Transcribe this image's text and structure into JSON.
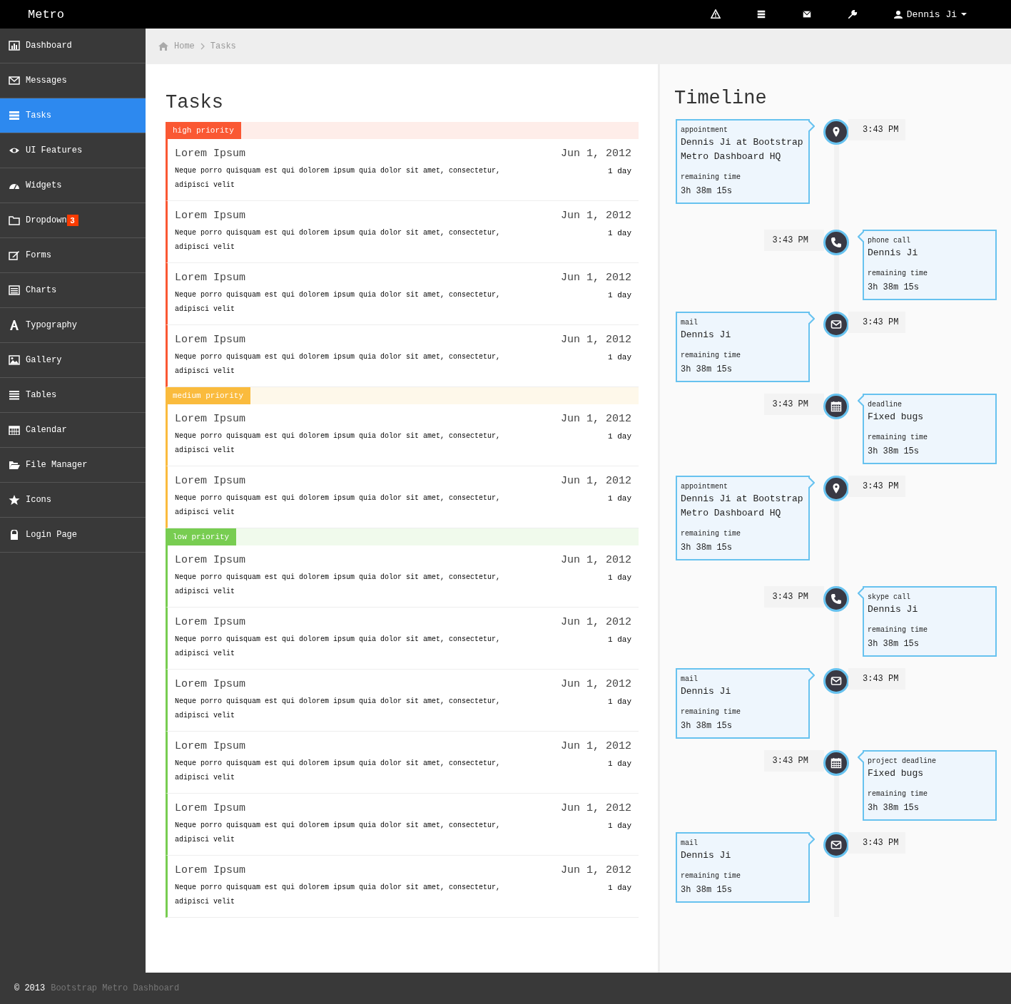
{
  "topbar": {
    "brand": "Metro",
    "user": "Dennis Ji"
  },
  "sidebar": {
    "items": [
      {
        "label": "Dashboard",
        "selected": false
      },
      {
        "label": "Messages",
        "selected": false
      },
      {
        "label": "Tasks",
        "selected": true
      },
      {
        "label": "UI Features",
        "selected": false
      },
      {
        "label": "Widgets",
        "selected": false
      },
      {
        "label": "Dropdown",
        "selected": false,
        "badge": "3"
      },
      {
        "label": "Forms",
        "selected": false
      },
      {
        "label": "Charts",
        "selected": false
      },
      {
        "label": "Typography",
        "selected": false
      },
      {
        "label": "Gallery",
        "selected": false
      },
      {
        "label": "Tables",
        "selected": false
      },
      {
        "label": "Calendar",
        "selected": false
      },
      {
        "label": "File Manager",
        "selected": false
      },
      {
        "label": "Icons",
        "selected": false
      },
      {
        "label": "Login Page",
        "selected": false
      }
    ]
  },
  "breadcrumb": [
    "Home",
    "Tasks"
  ],
  "tasks": {
    "title": "Tasks",
    "groups": [
      {
        "label": "high priority",
        "color": "#fa5833",
        "items": [
          {
            "title": "Lorem Ipsum",
            "date": "Jun 1, 2012",
            "text": "Neque porro quisquam est qui dolorem ipsum quia dolor sit amet, consectetur, adipisci velit",
            "duration": "1 day"
          },
          {
            "title": "Lorem Ipsum",
            "date": "Jun 1, 2012",
            "text": "Neque porro quisquam est qui dolorem ipsum quia dolor sit amet, consectetur, adipisci velit",
            "duration": "1 day"
          },
          {
            "title": "Lorem Ipsum",
            "date": "Jun 1, 2012",
            "text": "Neque porro quisquam est qui dolorem ipsum quia dolor sit amet, consectetur, adipisci velit",
            "duration": "1 day"
          },
          {
            "title": "Lorem Ipsum",
            "date": "Jun 1, 2012",
            "text": "Neque porro quisquam est qui dolorem ipsum quia dolor sit amet, consectetur, adipisci velit",
            "duration": "1 day"
          }
        ]
      },
      {
        "label": "medium priority",
        "color": "#fabb3d",
        "items": [
          {
            "title": "Lorem Ipsum",
            "date": "Jun 1, 2012",
            "text": "Neque porro quisquam est qui dolorem ipsum quia dolor sit amet, consectetur, adipisci velit",
            "duration": "1 day"
          },
          {
            "title": "Lorem Ipsum",
            "date": "Jun 1, 2012",
            "text": "Neque porro quisquam est qui dolorem ipsum quia dolor sit amet, consectetur, adipisci velit",
            "duration": "1 day"
          }
        ]
      },
      {
        "label": "low priority",
        "color": "#78cd51",
        "items": [
          {
            "title": "Lorem Ipsum",
            "date": "Jun 1, 2012",
            "text": "Neque porro quisquam est qui dolorem ipsum quia dolor sit amet, consectetur, adipisci velit",
            "duration": "1 day"
          },
          {
            "title": "Lorem Ipsum",
            "date": "Jun 1, 2012",
            "text": "Neque porro quisquam est qui dolorem ipsum quia dolor sit amet, consectetur, adipisci velit",
            "duration": "1 day"
          },
          {
            "title": "Lorem Ipsum",
            "date": "Jun 1, 2012",
            "text": "Neque porro quisquam est qui dolorem ipsum quia dolor sit amet, consectetur, adipisci velit",
            "duration": "1 day"
          },
          {
            "title": "Lorem Ipsum",
            "date": "Jun 1, 2012",
            "text": "Neque porro quisquam est qui dolorem ipsum quia dolor sit amet, consectetur, adipisci velit",
            "duration": "1 day"
          },
          {
            "title": "Lorem Ipsum",
            "date": "Jun 1, 2012",
            "text": "Neque porro quisquam est qui dolorem ipsum quia dolor sit amet, consectetur, adipisci velit",
            "duration": "1 day"
          },
          {
            "title": "Lorem Ipsum",
            "date": "Jun 1, 2012",
            "text": "Neque porro quisquam est qui dolorem ipsum quia dolor sit amet, consectetur, adipisci velit",
            "duration": "1 day"
          }
        ]
      }
    ]
  },
  "timeline": {
    "title": "Timeline",
    "entries": [
      {
        "kind": "left",
        "category": "appointment",
        "title": "Dennis Ji at Bootstrap Metro Dashboard HQ",
        "label": "remaining time",
        "remaining": "3h 38m 15s",
        "time": "3:43 PM"
      },
      {
        "kind": "right",
        "category": "phone call",
        "title": "Dennis Ji",
        "label": "remaining time",
        "remaining": "3h 38m 15s",
        "time": "3:43 PM"
      },
      {
        "kind": "left",
        "category": "mail",
        "title": "Dennis Ji",
        "label": "remaining time",
        "remaining": "3h 38m 15s",
        "time": "3:43 PM"
      },
      {
        "kind": "right",
        "category": "deadline",
        "title": "Fixed bugs",
        "label": "remaining time",
        "remaining": "3h 38m 15s",
        "time": "3:43 PM"
      },
      {
        "kind": "left",
        "category": "appointment",
        "title": "Dennis Ji at Bootstrap Metro Dashboard HQ",
        "label": "remaining time",
        "remaining": "3h 38m 15s",
        "time": "3:43 PM"
      },
      {
        "kind": "right",
        "category": "skype call",
        "title": "Dennis Ji",
        "label": "remaining time",
        "remaining": "3h 38m 15s",
        "time": "3:43 PM"
      },
      {
        "kind": "left",
        "category": "mail",
        "title": "Dennis Ji",
        "label": "remaining time",
        "remaining": "3h 38m 15s",
        "time": "3:43 PM"
      },
      {
        "kind": "right",
        "category": "project deadline",
        "title": "Fixed bugs",
        "label": "remaining time",
        "remaining": "3h 38m 15s",
        "time": "3:43 PM"
      },
      {
        "kind": "left",
        "category": "mail",
        "title": "Dennis Ji",
        "label": "remaining time",
        "remaining": "3h 38m 15s",
        "time": "3:43 PM"
      }
    ]
  },
  "footer": {
    "copyright": "© 2013",
    "link": "Bootstrap Metro Dashboard"
  }
}
